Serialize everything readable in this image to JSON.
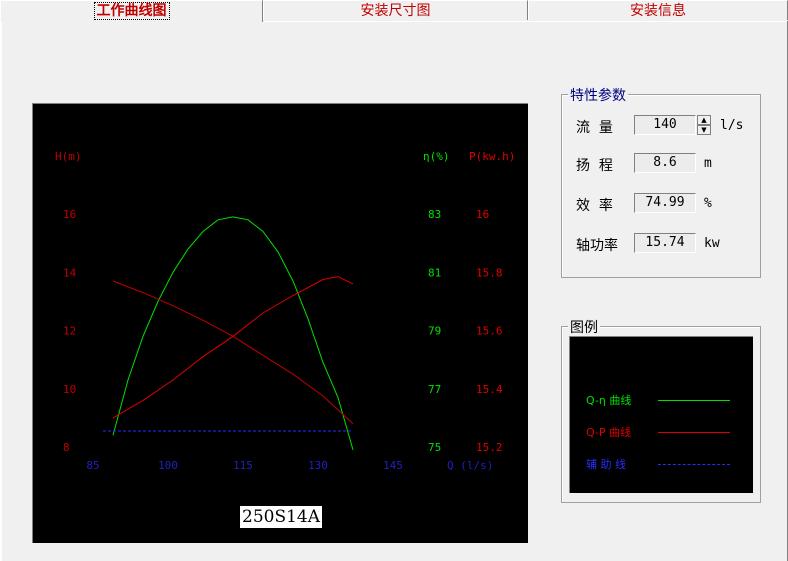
{
  "tabs": [
    {
      "label": "工作曲线图",
      "active": true
    },
    {
      "label": "安装尺寸图",
      "active": false
    },
    {
      "label": "安装信息",
      "active": false
    }
  ],
  "chart": {
    "model": "250S14A",
    "labels": {
      "h_axis": "H(m)",
      "eta_axis": "η(%)",
      "p_axis": "P(kw.h)",
      "q_axis": "Q (l/s)"
    },
    "colors": {
      "h": "#c00000",
      "eta": "#00e000",
      "p": "#e00000",
      "q": "#2020c0",
      "aux": "#2a2aff"
    }
  },
  "chart_data": {
    "type": "line",
    "x_ticks": [
      "85",
      "100",
      "115",
      "130",
      "145"
    ],
    "h_ticks": [
      "16",
      "14",
      "12",
      "10",
      "8"
    ],
    "eta_ticks": [
      "83",
      "81",
      "79",
      "77",
      "75"
    ],
    "p_ticks": [
      "16",
      "15.8",
      "15.6",
      "15.4",
      "15.2"
    ],
    "xlim": [
      85,
      145
    ],
    "h_lim": [
      8,
      16
    ],
    "eta_lim": [
      75,
      83
    ],
    "p_lim": [
      15.2,
      16
    ],
    "series": [
      {
        "name": "Q-η 曲线",
        "axis": "eta",
        "color": "#00e000",
        "x": [
          89,
          92,
          95,
          98,
          101,
          104,
          107,
          110,
          113,
          116,
          119,
          122,
          125,
          128,
          131,
          134,
          137
        ],
        "y": [
          75.4,
          77.3,
          78.8,
          80.0,
          81.0,
          81.8,
          82.4,
          82.8,
          82.9,
          82.8,
          82.4,
          81.7,
          80.7,
          79.4,
          77.9,
          76.7,
          74.9
        ]
      },
      {
        "name": "Q-P 曲线",
        "axis": "p",
        "color": "#e00000",
        "x": [
          89,
          95,
          101,
          107,
          113,
          119,
          125,
          131,
          134,
          137
        ],
        "y": [
          15.3,
          15.36,
          15.43,
          15.51,
          15.58,
          15.66,
          15.72,
          15.775,
          15.785,
          15.76
        ]
      },
      {
        "name": "H-Q",
        "axis": "h",
        "color": "#c00000",
        "x": [
          89,
          95,
          101,
          107,
          113,
          119,
          125,
          131,
          137
        ],
        "y": [
          13.7,
          13.3,
          12.85,
          12.35,
          11.8,
          11.15,
          10.5,
          9.75,
          8.8
        ]
      },
      {
        "name": "辅助线",
        "axis": "eta",
        "color": "#2a2aff",
        "dashed": true,
        "x": [
          87,
          137
        ],
        "y": [
          75.55,
          75.55
        ]
      }
    ]
  },
  "params": {
    "title": "特性参数",
    "rows": [
      {
        "name": "流  量",
        "value": "140",
        "unit": "l/s",
        "spinner": true
      },
      {
        "name": "扬  程",
        "value": "8.6",
        "unit": "m"
      },
      {
        "name": "效  率",
        "value": "74.99",
        "unit": "%"
      },
      {
        "name": "轴功率",
        "value": "15.74",
        "unit": "kw"
      }
    ]
  },
  "legend": {
    "title": "图例",
    "items": [
      {
        "label": "Q-η 曲线",
        "color": "#00e000",
        "style": "solid"
      },
      {
        "label": "Q-P 曲线",
        "color": "#e00000",
        "style": "solid"
      },
      {
        "label": "辅 助 线",
        "color": "#2a2aff",
        "style": "dashed"
      }
    ]
  }
}
